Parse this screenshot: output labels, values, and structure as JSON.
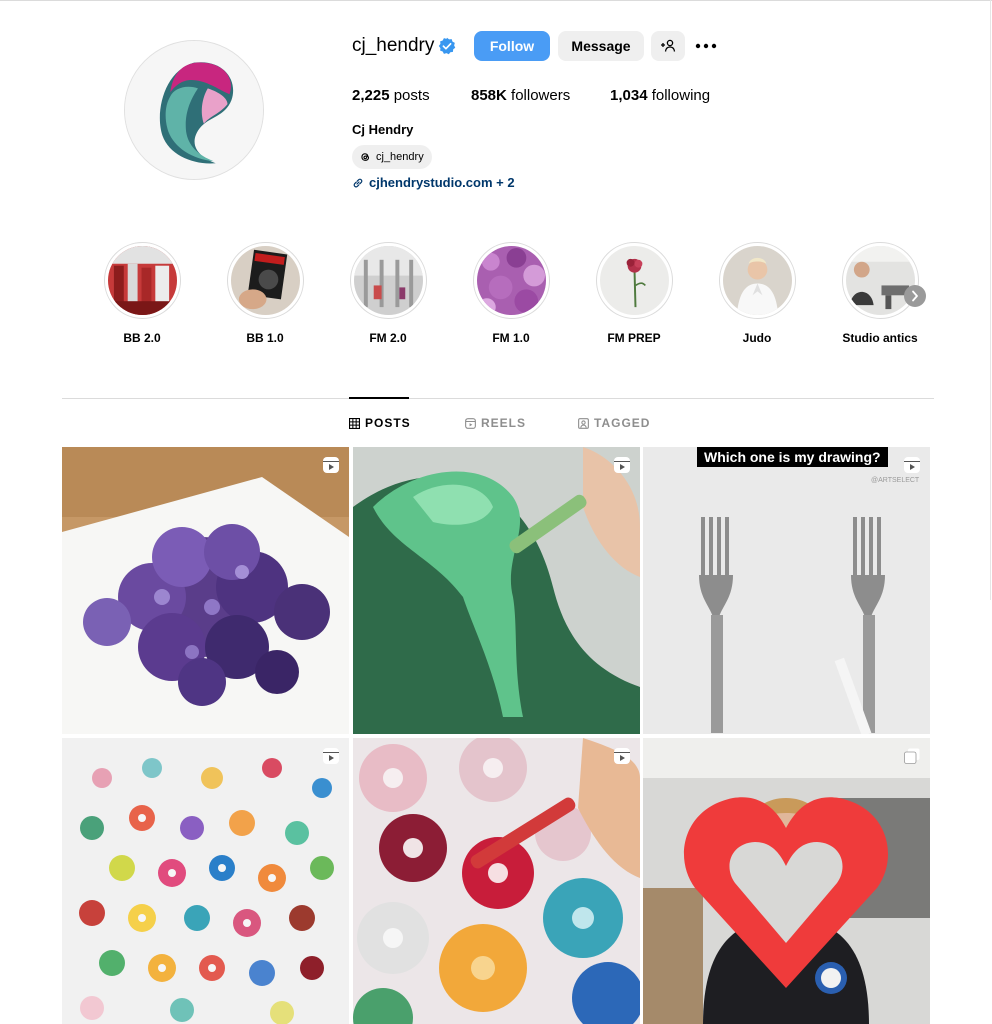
{
  "profile": {
    "username": "cj_hendry",
    "full_name": "Cj Hendry",
    "threads_handle": "cj_hendry",
    "link_text": "cjhendrystudio.com + 2",
    "verified": true
  },
  "actions": {
    "follow": "Follow",
    "message": "Message"
  },
  "stats": {
    "posts_count": "2,225",
    "posts_label": "posts",
    "followers_count": "858K",
    "followers_label": "followers",
    "following_count": "1,034",
    "following_label": "following"
  },
  "highlights": [
    {
      "label": "BB 2.0"
    },
    {
      "label": "BB 1.0"
    },
    {
      "label": "FM 2.0"
    },
    {
      "label": "FM 1.0"
    },
    {
      "label": "FM PREP"
    },
    {
      "label": "Judo"
    },
    {
      "label": "Studio antics"
    }
  ],
  "tabs": {
    "posts": "POSTS",
    "reels": "REELS",
    "tagged": "TAGGED"
  },
  "posts": [
    {
      "type_icon": "reel-icon"
    },
    {
      "type_icon": "reel-icon"
    },
    {
      "type_icon": "reel-icon",
      "overlay_text": "Which one is my drawing?",
      "watermark": "@ARTSELECT"
    },
    {
      "type_icon": "reel-icon"
    },
    {
      "type_icon": "reel-icon"
    },
    {
      "type_icon": "carousel-icon"
    }
  ],
  "colors": {
    "follow_button": "#4a9cf5",
    "secondary_button": "#efefef",
    "link": "#00376b",
    "verified_badge": "#3897f0"
  }
}
